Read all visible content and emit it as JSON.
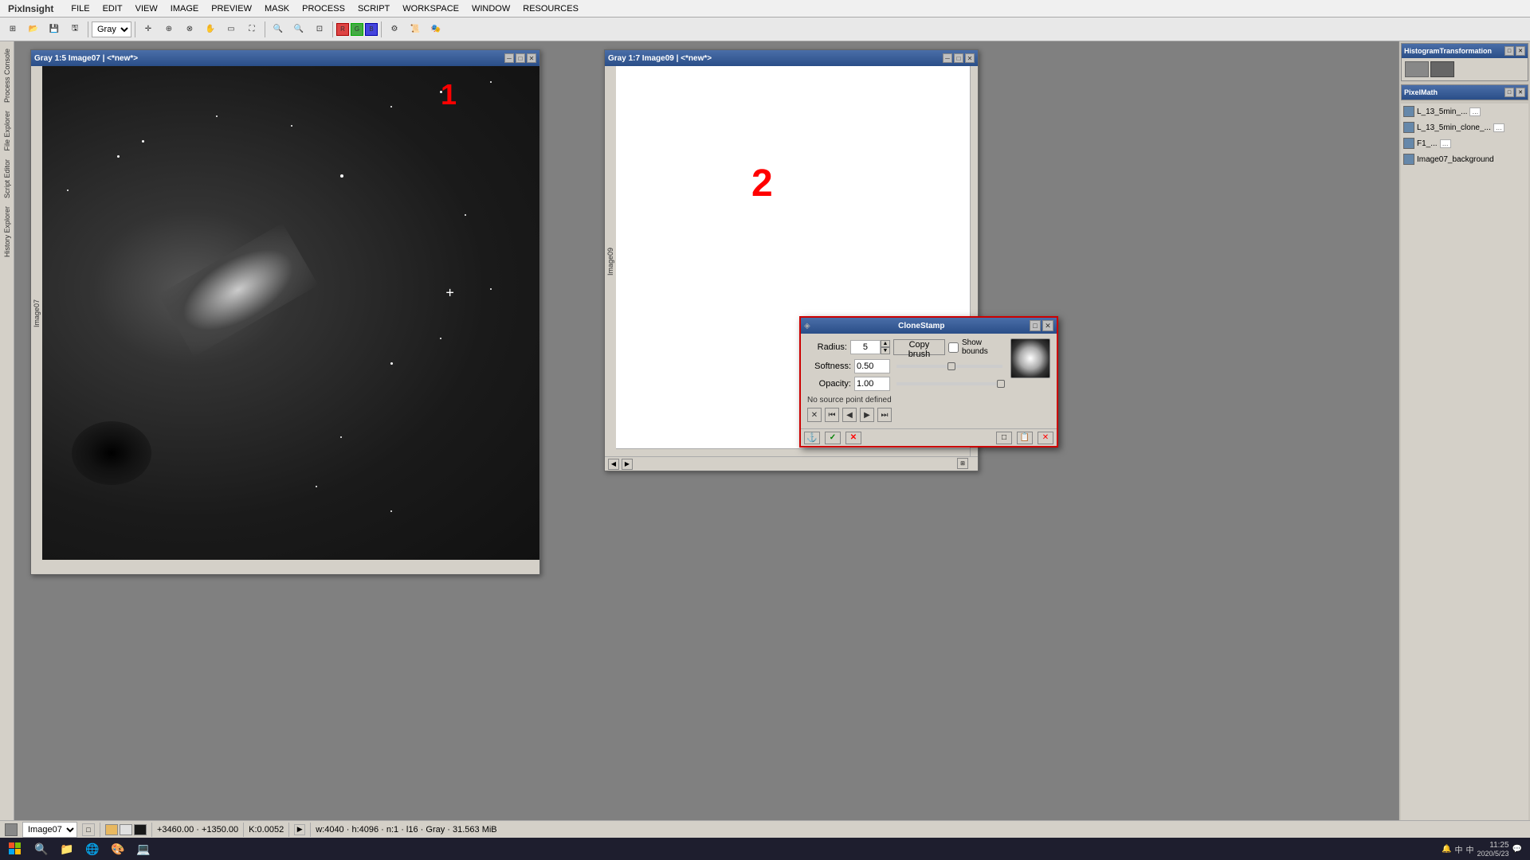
{
  "app": {
    "title": "PixInsight",
    "version": ""
  },
  "menubar": {
    "items": [
      "FILE",
      "EDIT",
      "VIEW",
      "IMAGE",
      "PREVIEW",
      "MASK",
      "PROCESS",
      "SCRIPT",
      "WORKSPACE",
      "WINDOW",
      "RESOURCES"
    ]
  },
  "toolbar": {
    "color_profile": "Gray"
  },
  "image_window_07": {
    "title": "Gray 1:5  Image07 | <*new*>",
    "label": "1",
    "label2": "Image07"
  },
  "image_window_09": {
    "title": "Gray 1:7  Image09 | <*new*>",
    "label": "2",
    "label2": "Image09"
  },
  "clone_stamp": {
    "title": "CloneStamp",
    "radius_label": "Radius:",
    "radius_value": "5",
    "copy_brush_label": "Copy brush",
    "show_bounds_label": "Show bounds",
    "softness_label": "Softness:",
    "softness_value": "0.50",
    "softness_slider_pct": 50,
    "opacity_label": "Opacity:",
    "opacity_value": "1.00",
    "opacity_slider_pct": 100,
    "status_text": "No source point defined",
    "nav_buttons": [
      "⏮",
      "◀",
      "▶",
      "⏭"
    ],
    "footer_buttons": [
      "anchor",
      "check",
      "x"
    ]
  },
  "right_panel": {
    "histogram_title": "HistogramTransformation",
    "pixelmath_title": "PixelMath",
    "items": [
      {
        "label": "L_13_5min_...",
        "icon": "layer"
      },
      {
        "label": "L_13_5min_clone_...",
        "icon": "layer"
      },
      {
        "label": "F1_...",
        "icon": "layer"
      },
      {
        "label": "Image07_background",
        "icon": "layer"
      }
    ]
  },
  "statusbar": {
    "image_select": "Image07",
    "coordinates": "+3460.00 · +1350.00",
    "k_value": "K:0.0052",
    "play_btn": "▶",
    "image_info": "w:4040 · h:4096 · n:1 · l16 · Gray · 31.563 MiB",
    "time": "11:25",
    "date": "2020/5/23"
  },
  "icons": {
    "minimize": "─",
    "maximize": "□",
    "close": "✕",
    "restore": "❐",
    "pin": "□",
    "anchor": "⚓",
    "check": "✓",
    "x": "✕",
    "arrow_left": "◀",
    "arrow_right": "▶",
    "skip_back": "⏮",
    "skip_fwd": "⏭",
    "up": "▲",
    "down": "▼"
  }
}
